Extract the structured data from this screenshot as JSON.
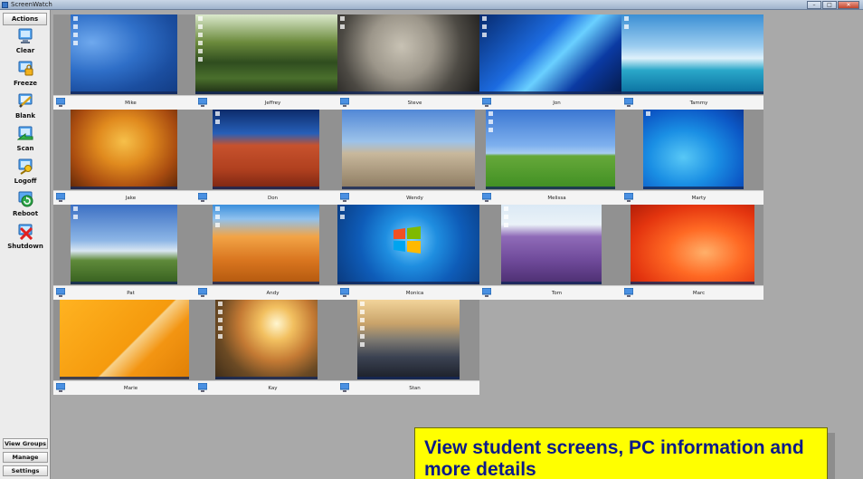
{
  "window": {
    "title": "ScreenWatch",
    "controls": {
      "minimize": "–",
      "maximize": "□",
      "close": "✕"
    }
  },
  "sidebar": {
    "header": "Actions",
    "actions": [
      {
        "id": "clear",
        "label": "Clear",
        "icon": "monitor-clear-icon"
      },
      {
        "id": "freeze",
        "label": "Freeze",
        "icon": "monitor-lock-icon"
      },
      {
        "id": "blank",
        "label": "Blank",
        "icon": "monitor-blank-icon"
      },
      {
        "id": "scan",
        "label": "Scan",
        "icon": "monitor-scan-icon"
      },
      {
        "id": "logoff",
        "label": "Logoff",
        "icon": "key-icon"
      },
      {
        "id": "reboot",
        "label": "Reboot",
        "icon": "reboot-icon"
      },
      {
        "id": "shutdown",
        "label": "Shutdown",
        "icon": "shutdown-icon"
      }
    ],
    "bottom_buttons": [
      "View Groups",
      "Manage",
      "Settings"
    ]
  },
  "students": [
    {
      "name": "Mike",
      "wallpaper": "wp-xp"
    },
    {
      "name": "Jeffrey",
      "wallpaper": "wp-forest"
    },
    {
      "name": "Steve",
      "wallpaper": "wp-moon"
    },
    {
      "name": "Jon",
      "wallpaper": "wp-aurora"
    },
    {
      "name": "Tammy",
      "wallpaper": "wp-beach"
    },
    {
      "name": "Jake",
      "wallpaper": "wp-autumn"
    },
    {
      "name": "Don",
      "wallpaper": "wp-dune"
    },
    {
      "name": "Wendy",
      "wallpaper": "wp-car"
    },
    {
      "name": "Melissa",
      "wallpaper": "wp-bliss"
    },
    {
      "name": "Marty",
      "wallpaper": "wp-blue"
    },
    {
      "name": "Pat",
      "wallpaper": "wp-stone"
    },
    {
      "name": "Andy",
      "wallpaper": "wp-desert"
    },
    {
      "name": "Monica",
      "wallpaper": "wp-win7"
    },
    {
      "name": "Tom",
      "wallpaper": "wp-lavender"
    },
    {
      "name": "Marc",
      "wallpaper": "wp-red"
    },
    {
      "name": "Marie",
      "wallpaper": "wp-win8"
    },
    {
      "name": "Kay",
      "wallpaper": "wp-sunset"
    },
    {
      "name": "Stan",
      "wallpaper": "wp-mountain"
    }
  ],
  "promo": {
    "text": "View student screens, PC information and more details"
  },
  "colors": {
    "background": "#a9a9a9",
    "promo_bg": "#ffff00",
    "promo_text": "#0b1a8a"
  }
}
